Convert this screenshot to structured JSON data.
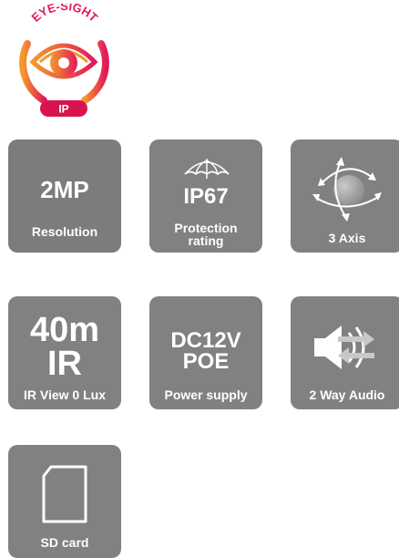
{
  "logo": {
    "text": "EYE-SIGHT",
    "badge": "IP",
    "colors": {
      "gradient_start": "#f39a2b",
      "gradient_end": "#e2195a",
      "badge": "#d8144e"
    }
  },
  "tile_color": "#808181",
  "features": {
    "resolution": {
      "value": "2MP",
      "label": "Resolution"
    },
    "protection": {
      "value": "IP67",
      "label_line1": "Protection",
      "label_line2": "rating",
      "icon": "umbrella-icon"
    },
    "axis": {
      "label": "3 Axis",
      "icon": "rotation-axis-icon"
    },
    "ir": {
      "value_line1": "40m",
      "value_line2": "IR",
      "label": "IR View 0 Lux"
    },
    "power": {
      "value_line1": "DC12V",
      "value_line2": "POE",
      "label": "Power supply"
    },
    "audio": {
      "label": "2 Way Audio",
      "icon": "speaker-two-way-icon"
    },
    "sdcard": {
      "label": "SD card",
      "icon": "sd-card-icon"
    }
  }
}
